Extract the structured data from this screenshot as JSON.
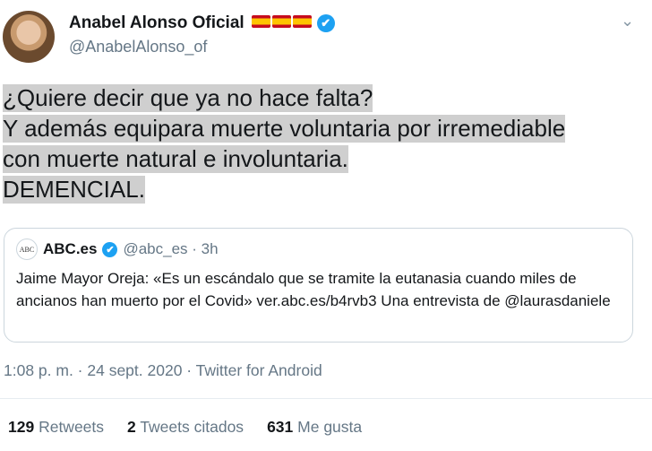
{
  "author": {
    "display_name": "Anabel Alonso Oficial",
    "handle": "@AnabelAlonso_of"
  },
  "tweet": {
    "lines": [
      "¿Quiere decir que  ya no hace falta?",
      "Y además  equipara muerte voluntaria por irremediable",
      "con muerte natural e involuntaria.",
      "DEMENCIAL."
    ],
    "timestamp": "1:08 p. m. · 24 sept. 2020 · Twitter for Android"
  },
  "quoted": {
    "logo_text": "ABC",
    "name": "ABC.es",
    "meta": "@abc_es · 3h",
    "text": "Jaime Mayor Oreja: «Es un escándalo que se tramite la eutanasia cuando miles de ancianos han muerto por el Covid» ver.abc.es/b4rvb3 Una entrevista de @laurasdaniele"
  },
  "stats": {
    "retweets_count": "129",
    "retweets_label": "Retweets",
    "quotes_count": "2",
    "quotes_label": "Tweets citados",
    "likes_count": "631",
    "likes_label": "Me gusta"
  },
  "icons": {
    "verified": "✔",
    "caret": "⌄"
  }
}
